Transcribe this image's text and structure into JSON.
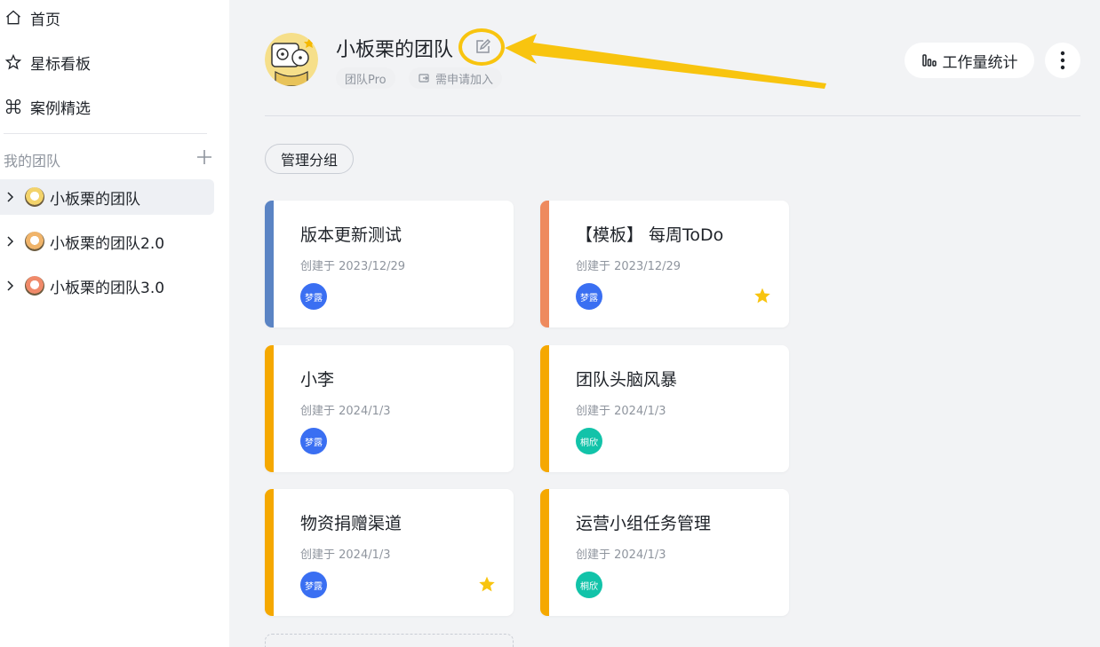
{
  "sidebar": {
    "nav": [
      {
        "label": "首页",
        "icon": "home-icon"
      },
      {
        "label": "星标看板",
        "icon": "star-outline-icon"
      },
      {
        "label": "案例精选",
        "icon": "command-icon"
      }
    ],
    "section_title": "我的团队",
    "teams": [
      {
        "label": "小板栗的团队",
        "active": true
      },
      {
        "label": "小板栗的团队2.0",
        "active": false
      },
      {
        "label": "小板栗的团队3.0",
        "active": false
      }
    ]
  },
  "header": {
    "team_name": "小板栗的团队",
    "tags": [
      "团队Pro",
      "需申请加入"
    ],
    "stats_label": "工作量统计"
  },
  "manage_group_label": "管理分组",
  "colors": {
    "blue_stripe": "#5b84c4",
    "orange_stripe": "#ee8a5e",
    "yellow_stripe": "#f5a800",
    "member_blue": "#3a6ff2",
    "member_teal": "#12c3a9",
    "star": "#f8c40f",
    "highlight": "#f8c40f"
  },
  "boards": [
    {
      "title": "版本更新测试",
      "created": "创建于 2023/12/29",
      "member": "梦露",
      "starred": false
    },
    {
      "title": "【模板】 每周ToDo",
      "created": "创建于 2023/12/29",
      "member": "梦露",
      "starred": true
    },
    {
      "title": "小李",
      "created": "创建于 2024/1/3",
      "member": "梦露",
      "starred": false
    },
    {
      "title": "团队头脑风暴",
      "created": "创建于 2024/1/3",
      "member": "桐欣",
      "starred": false
    },
    {
      "title": "物资捐赠渠道",
      "created": "创建于 2024/1/3",
      "member": "梦露",
      "starred": true
    },
    {
      "title": "运营小组任务管理",
      "created": "创建于 2024/1/3",
      "member": "桐欣",
      "starred": false
    }
  ]
}
